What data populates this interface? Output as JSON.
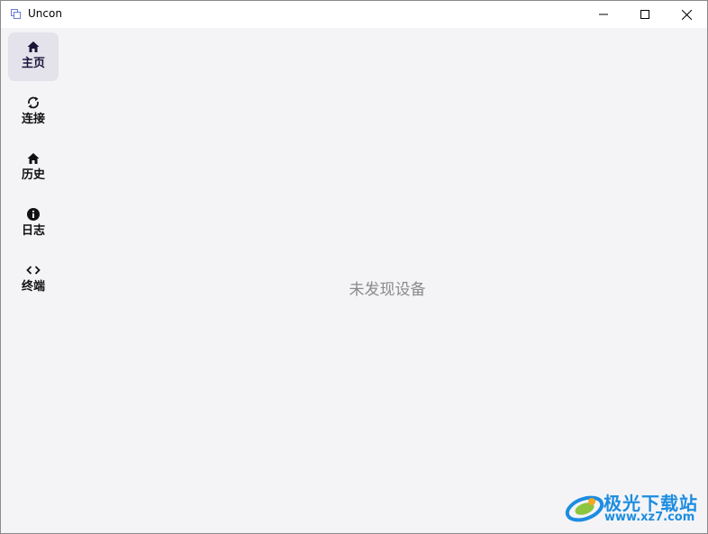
{
  "window": {
    "title": "Uncon",
    "controls": {
      "minimize": "minimize-icon",
      "maximize": "maximize-icon",
      "close": "close-icon"
    }
  },
  "sidebar": {
    "items": [
      {
        "label": "主页",
        "icon": "home-icon",
        "active": true
      },
      {
        "label": "连接",
        "icon": "sync-icon",
        "active": false
      },
      {
        "label": "历史",
        "icon": "home-icon",
        "active": false
      },
      {
        "label": "日志",
        "icon": "info-icon",
        "active": false
      },
      {
        "label": "终端",
        "icon": "code-icon",
        "active": false
      }
    ]
  },
  "main": {
    "empty_message": "未发现设备"
  },
  "watermark": {
    "title": "极光下载站",
    "url": "www.xz7.com"
  },
  "colors": {
    "accent": "#1a1438",
    "active_bg": "#e4e3ec",
    "content_bg": "#f4f4f7",
    "watermark": "#1c8de0"
  }
}
